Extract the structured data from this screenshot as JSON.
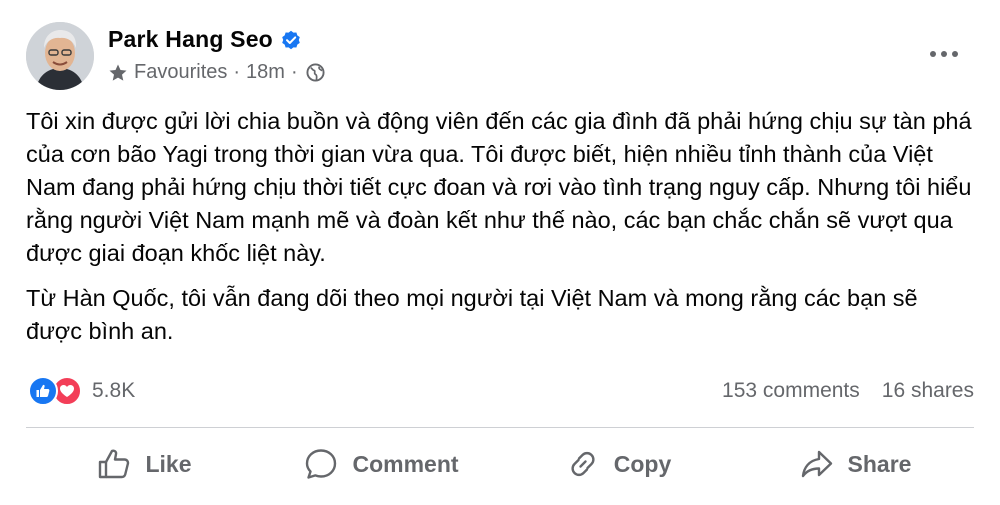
{
  "post": {
    "author": "Park Hang Seo",
    "verified": true,
    "audience": "Favourites",
    "time": "18m",
    "paragraphs": [
      "Tôi xin được gửi lời chia buồn và động viên đến các gia đình đã phải hứng chịu sự tàn phá của cơn bão Yagi trong thời gian vừa qua. Tôi được biết, hiện nhiều tỉnh thành của Việt Nam đang phải hứng chịu thời tiết cực đoan và rơi vào tình trạng nguy cấp. Nhưng tôi hiểu rằng người Việt Nam mạnh mẽ và đoàn kết như thế nào, các bạn chắc chắn sẽ vượt qua được giai đoạn khốc liệt này.",
      "Từ Hàn Quốc, tôi vẫn đang dõi theo mọi người tại Việt Nam và mong rằng các bạn sẽ được bình an."
    ]
  },
  "stats": {
    "reaction_icons": [
      "like-icon",
      "love-icon"
    ],
    "reactions": "5.8K",
    "comments": "153 comments",
    "shares": "16 shares"
  },
  "actions": {
    "like": "Like",
    "comment": "Comment",
    "copy": "Copy",
    "share": "Share"
  },
  "colors": {
    "verified_blue": "#1877f2",
    "like_blue": "#1877f2",
    "love_red": "#f33e58",
    "secondary_text": "#65676b",
    "primary_text": "#050505"
  }
}
